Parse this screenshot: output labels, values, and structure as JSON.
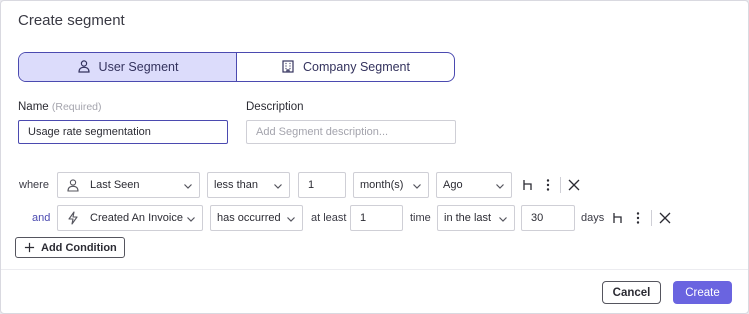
{
  "dialog": {
    "title": "Create segment"
  },
  "segment_type": {
    "options": [
      {
        "label": "User Segment",
        "icon": "user-icon",
        "active": true
      },
      {
        "label": "Company Segment",
        "icon": "building-icon",
        "active": false
      }
    ]
  },
  "form": {
    "name_label": "Name",
    "name_required": "(Required)",
    "name_value": "Usage rate segmentation",
    "description_label": "Description",
    "description_placeholder": "Add Segment description..."
  },
  "conditions": [
    {
      "connector": "where",
      "attribute": "Last Seen",
      "attribute_icon": "user-icon",
      "operator": "less than",
      "value": "1",
      "unit": "month(s)",
      "relation": "Ago"
    },
    {
      "connector": "and",
      "attribute": "Created An Invoice",
      "attribute_icon": "lightning-icon",
      "operator": "has occurred",
      "qualifier": "at least",
      "value": "1",
      "value_unit": "time",
      "window": "in the last",
      "window_value": "30",
      "window_unit": "days"
    }
  ],
  "add_condition_label": "Add Condition",
  "footer": {
    "cancel_label": "Cancel",
    "create_label": "Create"
  },
  "colors": {
    "accent": "#4b4ab0",
    "primary_button": "#6a64e0",
    "active_segment_bg": "#dcdcfb"
  }
}
